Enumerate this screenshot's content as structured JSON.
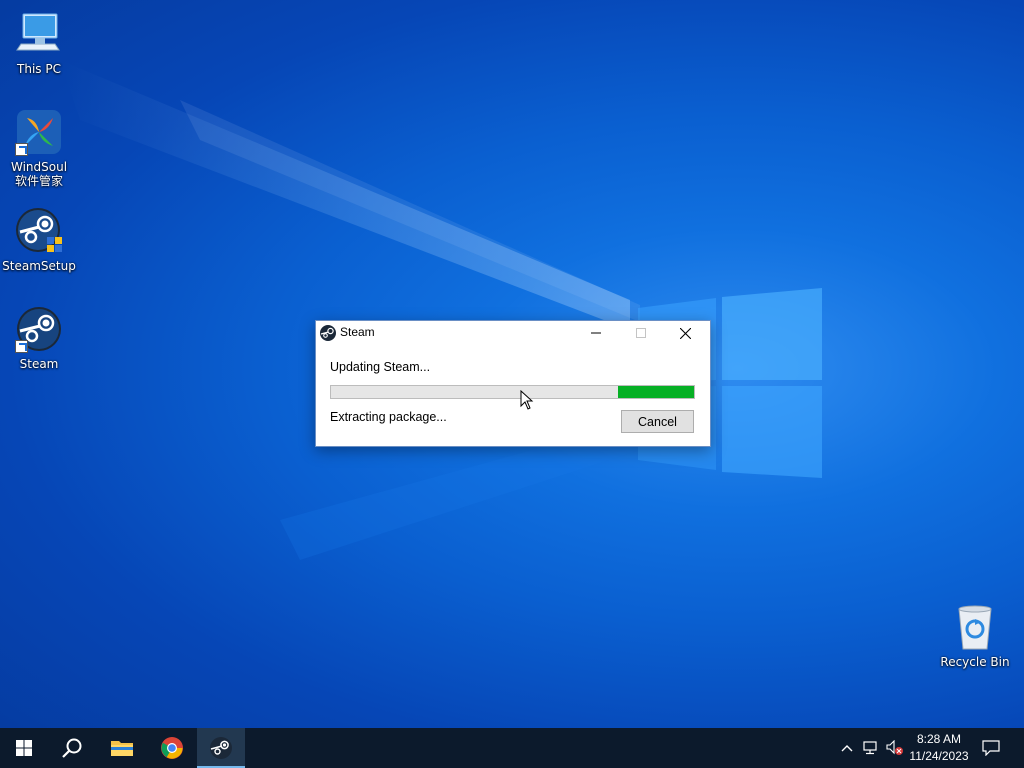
{
  "desktop": {
    "icons": [
      {
        "label": "This PC",
        "icon": "computer-icon"
      },
      {
        "label": "WindSoul软件管家",
        "icon": "windsoul-icon"
      },
      {
        "label": "SteamSetup",
        "icon": "steam-setup-icon"
      },
      {
        "label": "Steam",
        "icon": "steam-icon"
      },
      {
        "label": "Recycle Bin",
        "icon": "recycle-bin-icon"
      }
    ]
  },
  "dialog": {
    "title": "Steam",
    "status_main": "Updating Steam...",
    "status_detail": "Extracting package...",
    "progress_fraction": 0.21,
    "cancel_label": "Cancel",
    "progress_color": "#06b025"
  },
  "taskbar": {
    "items": [
      "start-button",
      "search-button",
      "file-explorer",
      "chrome",
      "steam"
    ],
    "active": "steam",
    "time": "8:28 AM",
    "date": "11/24/2023"
  }
}
